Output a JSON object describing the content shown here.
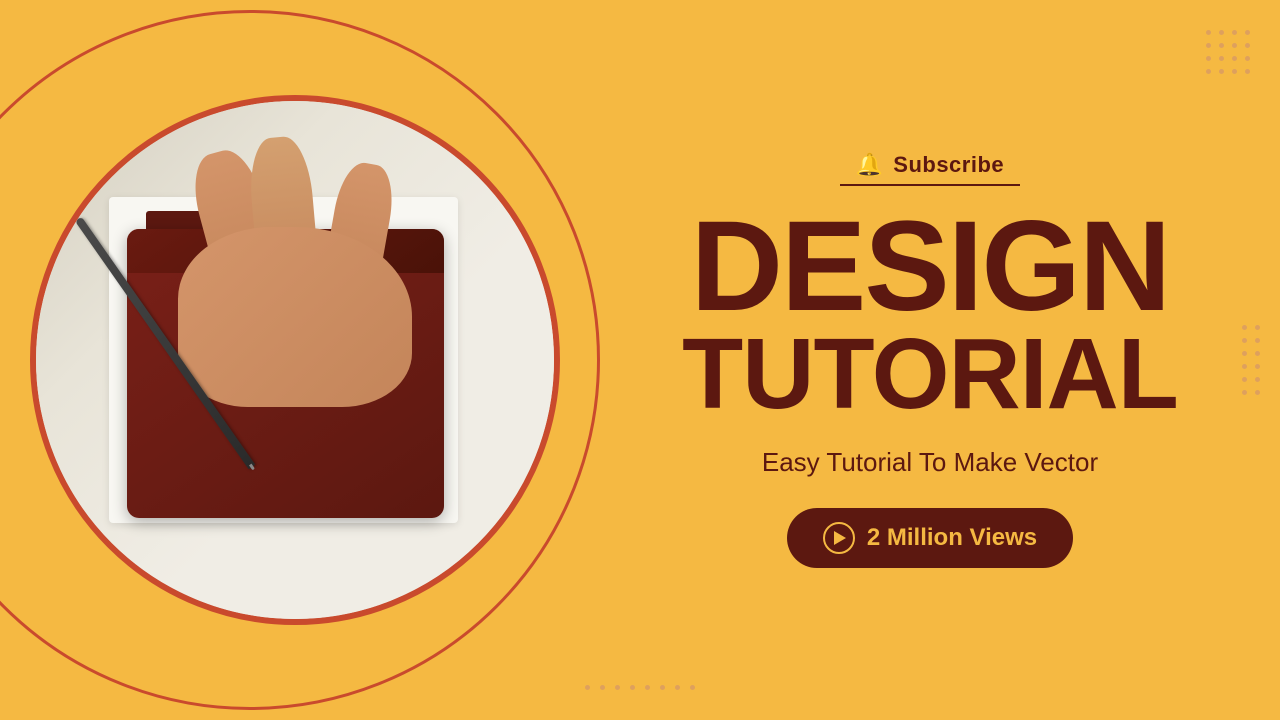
{
  "thumbnail": {
    "background_color": "#F5B942",
    "subscribe_label": "Subscribe",
    "title_line1": "DESIGN",
    "title_line2": "TUTORIAL",
    "subtitle": "Easy Tutorial To Make Vector",
    "views_badge": "2 Million Views",
    "accent_color": "#5c1810",
    "dot_color": "#d4956a"
  }
}
